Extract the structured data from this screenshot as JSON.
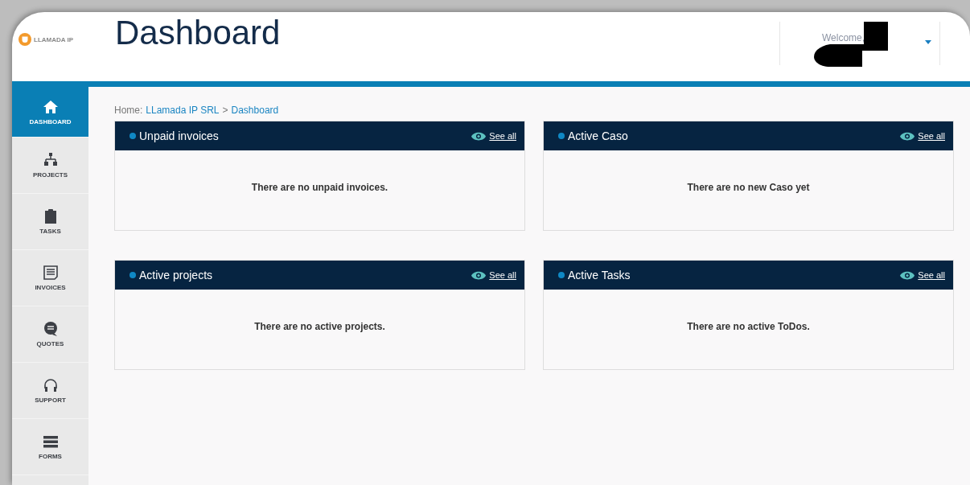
{
  "logo": {
    "text": "LLAMADA IP"
  },
  "header": {
    "title": "Dashboard",
    "welcome": "Welcome,"
  },
  "sidebar": {
    "items": [
      {
        "label": "DASHBOARD",
        "selected": true
      },
      {
        "label": "PROJECTS",
        "selected": false
      },
      {
        "label": "TASKS",
        "selected": false
      },
      {
        "label": "INVOICES",
        "selected": false
      },
      {
        "label": "QUOTES",
        "selected": false
      },
      {
        "label": "SUPPORT",
        "selected": false
      },
      {
        "label": "FORMS",
        "selected": false
      }
    ]
  },
  "breadcrumb": {
    "prefix": "Home:",
    "links": [
      "LLamada IP SRL",
      "Dashboard"
    ],
    "separator": ">"
  },
  "panels": [
    {
      "title": "Unpaid invoices",
      "link": "See all",
      "message": "There are no unpaid invoices."
    },
    {
      "title": "Active Caso",
      "link": "See all",
      "message": "There are no new Caso yet"
    },
    {
      "title": "Active projects",
      "link": "See all",
      "message": "There are no active projects."
    },
    {
      "title": "Active Tasks",
      "link": "See all",
      "message": "There are no active ToDos."
    }
  ]
}
